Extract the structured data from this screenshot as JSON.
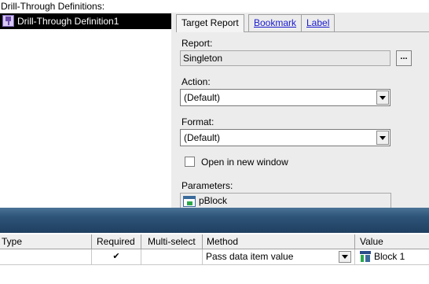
{
  "definitions": {
    "title": "Drill-Through Definitions:",
    "items": [
      {
        "label": "Drill-Through Definition1",
        "icon": "drill-through-icon",
        "selected": true
      }
    ]
  },
  "tabs": [
    {
      "label": "Target Report",
      "active": true
    },
    {
      "label": "Bookmark",
      "active": false
    },
    {
      "label": "Label",
      "active": false
    }
  ],
  "form": {
    "report_label": "Report:",
    "report_value": "Singleton",
    "browse_label": "...",
    "action_label": "Action:",
    "action_value": "(Default)",
    "format_label": "Format:",
    "format_value": "(Default)",
    "open_new_window_label": "Open in new window",
    "open_new_window_checked": false,
    "parameters_label": "Parameters:",
    "parameters_items": [
      {
        "label": "pBlock",
        "icon": "parameter-icon"
      }
    ]
  },
  "table": {
    "columns": [
      "Type",
      "Required",
      "Multi-select",
      "Method",
      "Value"
    ],
    "rows": [
      {
        "type": "",
        "required": "✔",
        "multi_select": "",
        "method": "Pass data item value",
        "value": "Block 1",
        "value_icon": "data-item-icon"
      }
    ]
  },
  "colors": {
    "splitter": "#2e5579",
    "selection": "#000000",
    "link": "#1a1ad0"
  }
}
